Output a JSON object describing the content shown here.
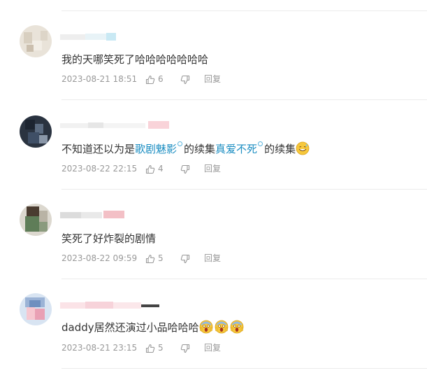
{
  "comments": [
    {
      "text": "我的天哪笑死了哈哈哈哈哈哈哈",
      "date": "2023-08-21 18:51",
      "likes": "6",
      "reply_label": "回复"
    },
    {
      "text_before": "不知道还以为是",
      "topic1": "歌剧魅影",
      "text_mid": "的续集",
      "topic2": "真爱不死",
      "text_after": "的续集",
      "date": "2023-08-22 22:15",
      "likes": "4",
      "reply_label": "回复"
    },
    {
      "text": "笑死了好炸裂的剧情",
      "date": "2023-08-22 09:59",
      "likes": "5",
      "reply_label": "回复"
    },
    {
      "text": "daddy居然还演过小品哈哈哈",
      "date": "2023-08-21 23:15",
      "likes": "5",
      "reply_label": "回复"
    }
  ],
  "icons": {
    "like": "thumbs-up-icon",
    "dislike": "thumbs-down-icon",
    "emoji_sweat": "sweat-smile-emoji",
    "emoji_scream": "scream-emoji"
  }
}
